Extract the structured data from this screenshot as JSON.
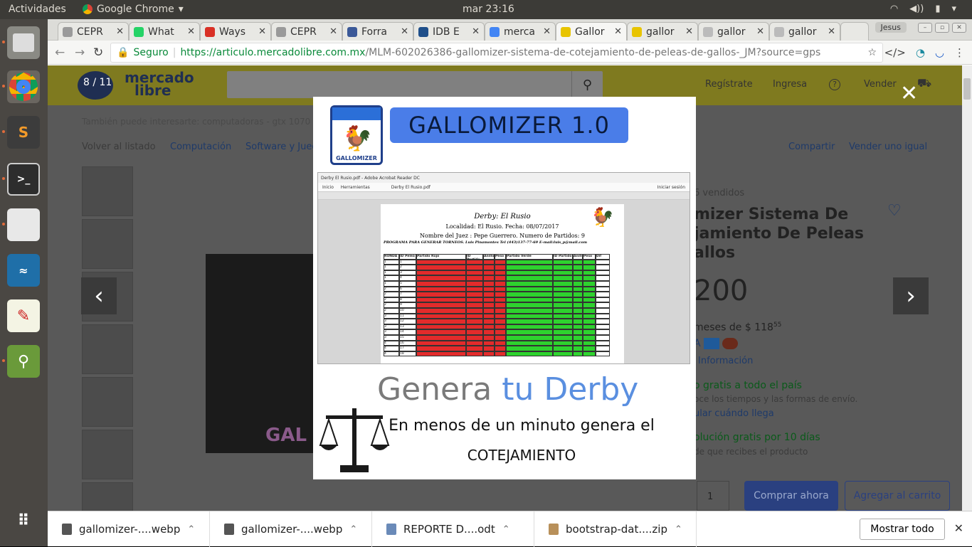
{
  "system": {
    "activities": "Actividades",
    "app_name": "Google Chrome",
    "clock": "mar 23:16"
  },
  "tabs": [
    {
      "label": "CEPR",
      "color": "#9a9a9a"
    },
    {
      "label": "What",
      "color": "#25d366"
    },
    {
      "label": "Ways",
      "color": "#d93025"
    },
    {
      "label": "CEPR",
      "color": "#9a9a9a"
    },
    {
      "label": "Forra",
      "color": "#3b5998"
    },
    {
      "label": "IDB E",
      "color": "#1f4f8a"
    },
    {
      "label": "merca",
      "color": "#4285f4"
    },
    {
      "label": "Gallor",
      "color": "#e8c400"
    },
    {
      "label": "gallor",
      "color": "#e8c400"
    },
    {
      "label": "gallor",
      "color": "#bbbbbb"
    },
    {
      "label": "gallor",
      "color": "#bbbbbb"
    }
  ],
  "user_label": "Jesus",
  "omnibox": {
    "secure": "Seguro",
    "url_host": "https://articulo.mercadolibre.com.mx",
    "url_path": "/MLM-602026386-gallomizer-sistema-de-cotejamiento-de-peleas-de-gallos-_JM?source=gps"
  },
  "ml": {
    "logo_line1": "mercado",
    "logo_line2": "libre",
    "counter": "8 / 11",
    "registrate": "Regístrate",
    "ingresa": "Ingresa",
    "vender": "Vender",
    "related": "También puede interesarte: computadoras - gtx 1070 - gt",
    "volver": "Volver al listado",
    "crumb1": "Computación",
    "crumb2": "Software y Jueg",
    "compartir": "Compartir",
    "vender_igual": "Vender uno igual",
    "vendidos": "6 vendidos",
    "title1": "mizer Sistema De",
    "title2": "jamiento De Peleas",
    "title3": "allos",
    "price": "200",
    "meses": "meses de $ 118",
    "meses_cents": "55",
    "info": "Información",
    "envio": "o gratis a todo el país",
    "envio2": "oce los tiempos y las formas de envío.",
    "calcular": "ular cuándo llega",
    "devolucion": "olución gratis por 10 días",
    "devolucion2": "de que recibes el producto",
    "qty": "1",
    "comprar": "Comprar ahora",
    "carrito": "Agregar al carrito"
  },
  "modal": {
    "product": "GALLOMIZER 1.0",
    "logo_caption": "GALLOMIZER",
    "window_title": "Derby El Rusio.pdf - Adobe Acrobat Reader DC",
    "tab_inicio": "Inicio",
    "tab_herr": "Herramientas",
    "tab_file": "Derby El Rusio.pdf",
    "login": "Iniciar sesión",
    "doc_title": "Derby: El Rusio",
    "doc_loc": "Localidad: El Rusio. Fecha: 08/07/2017",
    "doc_juez": "Nombre del Juez : Pepe Guerrero. Numero de Partidos: 9",
    "doc_prog": "PROGRAMA PARA GENERAR TORNEOS. Luis Pinamontes Tel (443)137-77-69 E-mail:luis_p@mail.com",
    "headers": [
      "RONDA",
      "ID Pelea",
      "Partido Rojo",
      "ID Partido",
      "Anillo",
      "Peso",
      "Partido Verde",
      "ID Partido",
      "Anillo",
      "Peso",
      "Dif"
    ],
    "rows": [
      [
        "1",
        "1"
      ],
      [
        "1",
        "2"
      ],
      [
        "1",
        "3"
      ],
      [
        "1",
        "4"
      ],
      [
        "1",
        "5"
      ],
      [
        "2",
        "6"
      ],
      [
        "2",
        "7"
      ],
      [
        "2",
        "8"
      ],
      [
        "2",
        "9"
      ],
      [
        "2",
        "10"
      ],
      [
        "3",
        "11"
      ],
      [
        "3",
        "12"
      ],
      [
        "3",
        "13"
      ],
      [
        "3",
        "14"
      ],
      [
        "3",
        "15"
      ],
      [
        "4",
        "16"
      ],
      [
        "4",
        "17"
      ],
      [
        "4",
        "18"
      ]
    ],
    "headline_a": "Genera",
    "headline_b": "tu Derby",
    "desc1": "En menos de un minuto genera el",
    "desc2": "COTEJAMIENTO"
  },
  "downloads": [
    {
      "name": "gallomizer-....webp"
    },
    {
      "name": "gallomizer-....webp"
    },
    {
      "name": "REPORTE  D....odt"
    },
    {
      "name": "bootstrap-dat....zip"
    }
  ],
  "show_all": "Mostrar todo"
}
